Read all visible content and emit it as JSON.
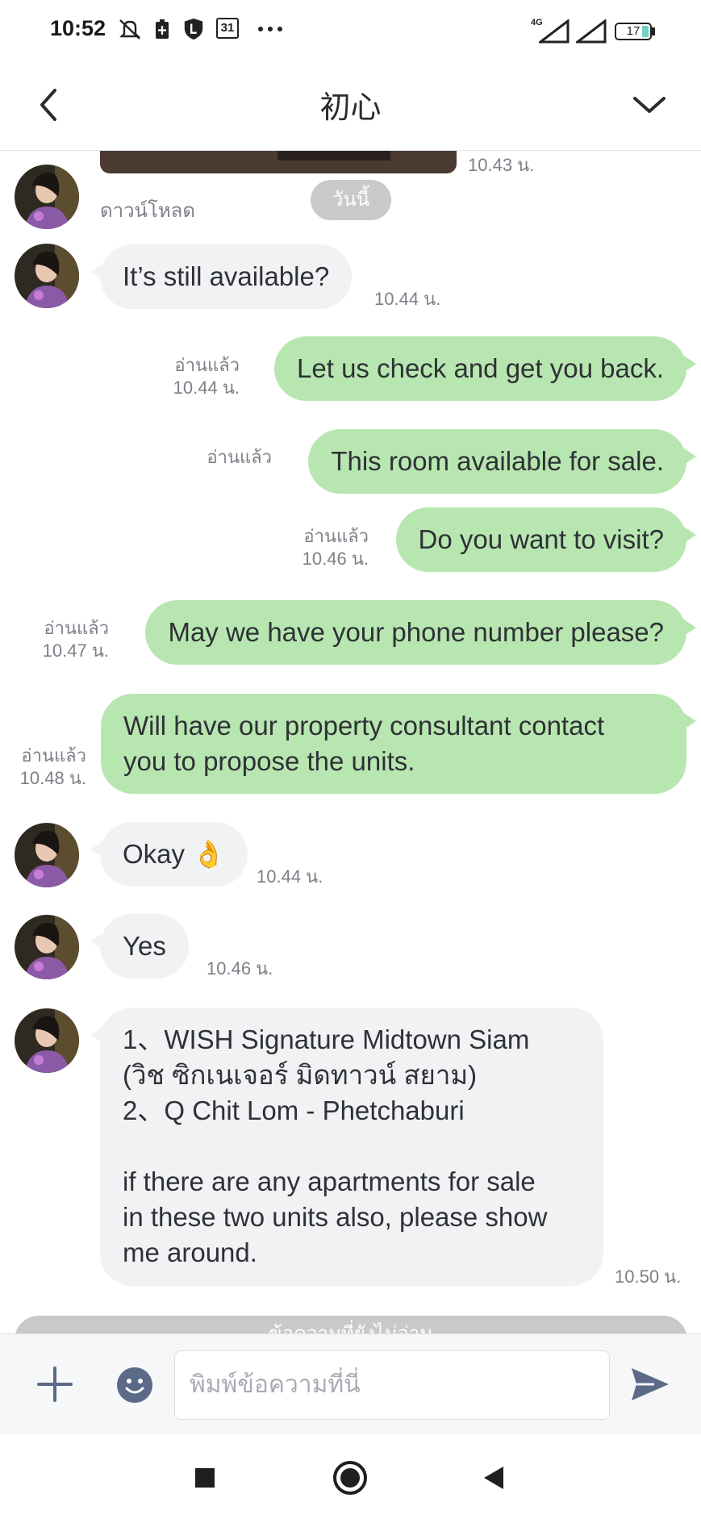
{
  "status_bar": {
    "time": "10:52",
    "icons": [
      "bell-off-icon",
      "battery-saver-icon",
      "shield-l-icon",
      "calendar-31-icon",
      "more-dots-icon"
    ],
    "calendar_day": "31",
    "network": "4G",
    "battery": "17"
  },
  "header": {
    "title": "初心",
    "back_icon": "chevron-left-icon",
    "menu_icon": "chevron-down-icon"
  },
  "chat": {
    "top_time": "10.43 น.",
    "date_chip": "วันนี้",
    "download_label": "ดาวน์โหลด",
    "messages": [
      {
        "dir": "in",
        "text": "It’s still available?",
        "time": "10.44 น."
      },
      {
        "dir": "out",
        "text": "Let us check and get you back.",
        "read": "อ่านแล้ว",
        "time": "10.44 น."
      },
      {
        "dir": "out",
        "text": "This room available for sale.",
        "read": "อ่านแล้ว"
      },
      {
        "dir": "out",
        "text": "Do you want to visit?",
        "read": "อ่านแล้ว",
        "time": "10.46 น."
      },
      {
        "dir": "out",
        "text": "May we have your phone number please?",
        "read": "อ่านแล้ว",
        "time": "10.47 น."
      },
      {
        "dir": "out",
        "line1": "Will have our property consultant contact",
        "line2": "you to propose the units.",
        "read": "อ่านแล้ว",
        "time": "10.48 น."
      },
      {
        "dir": "in",
        "text": "Okay 👌",
        "time": "10.44 น."
      },
      {
        "dir": "in",
        "text": "Yes",
        "time": "10.46 น."
      },
      {
        "dir": "in",
        "line1": "1、WISH Signature Midtown Siam",
        "line2": "(วิช ซิกเนเจอร์ มิดทาวน์ สยาม)",
        "line3": "2、Q Chit Lom - Phetchaburi",
        "line4": "if there are any apartments for sale",
        "line5": "in these two units also, please show",
        "line6": "me around.",
        "time": "10.50 น."
      }
    ],
    "unread_banner": "ข้อความที่ยังไม่อ่าน"
  },
  "input_bar": {
    "placeholder": "พิมพ์ข้อความที่นี่",
    "plus_icon": "plus-icon",
    "emoji_icon": "emoji-icon",
    "send_icon": "send-icon"
  },
  "nav_bar": {
    "icons": [
      "recents-square-icon",
      "home-circle-icon",
      "back-triangle-icon"
    ]
  },
  "colors": {
    "outgoing_bubble": "#b8e6b0",
    "incoming_bubble": "#f1f2f4",
    "meta_text": "#7d8088",
    "icon_slate": "#5b6a86"
  }
}
